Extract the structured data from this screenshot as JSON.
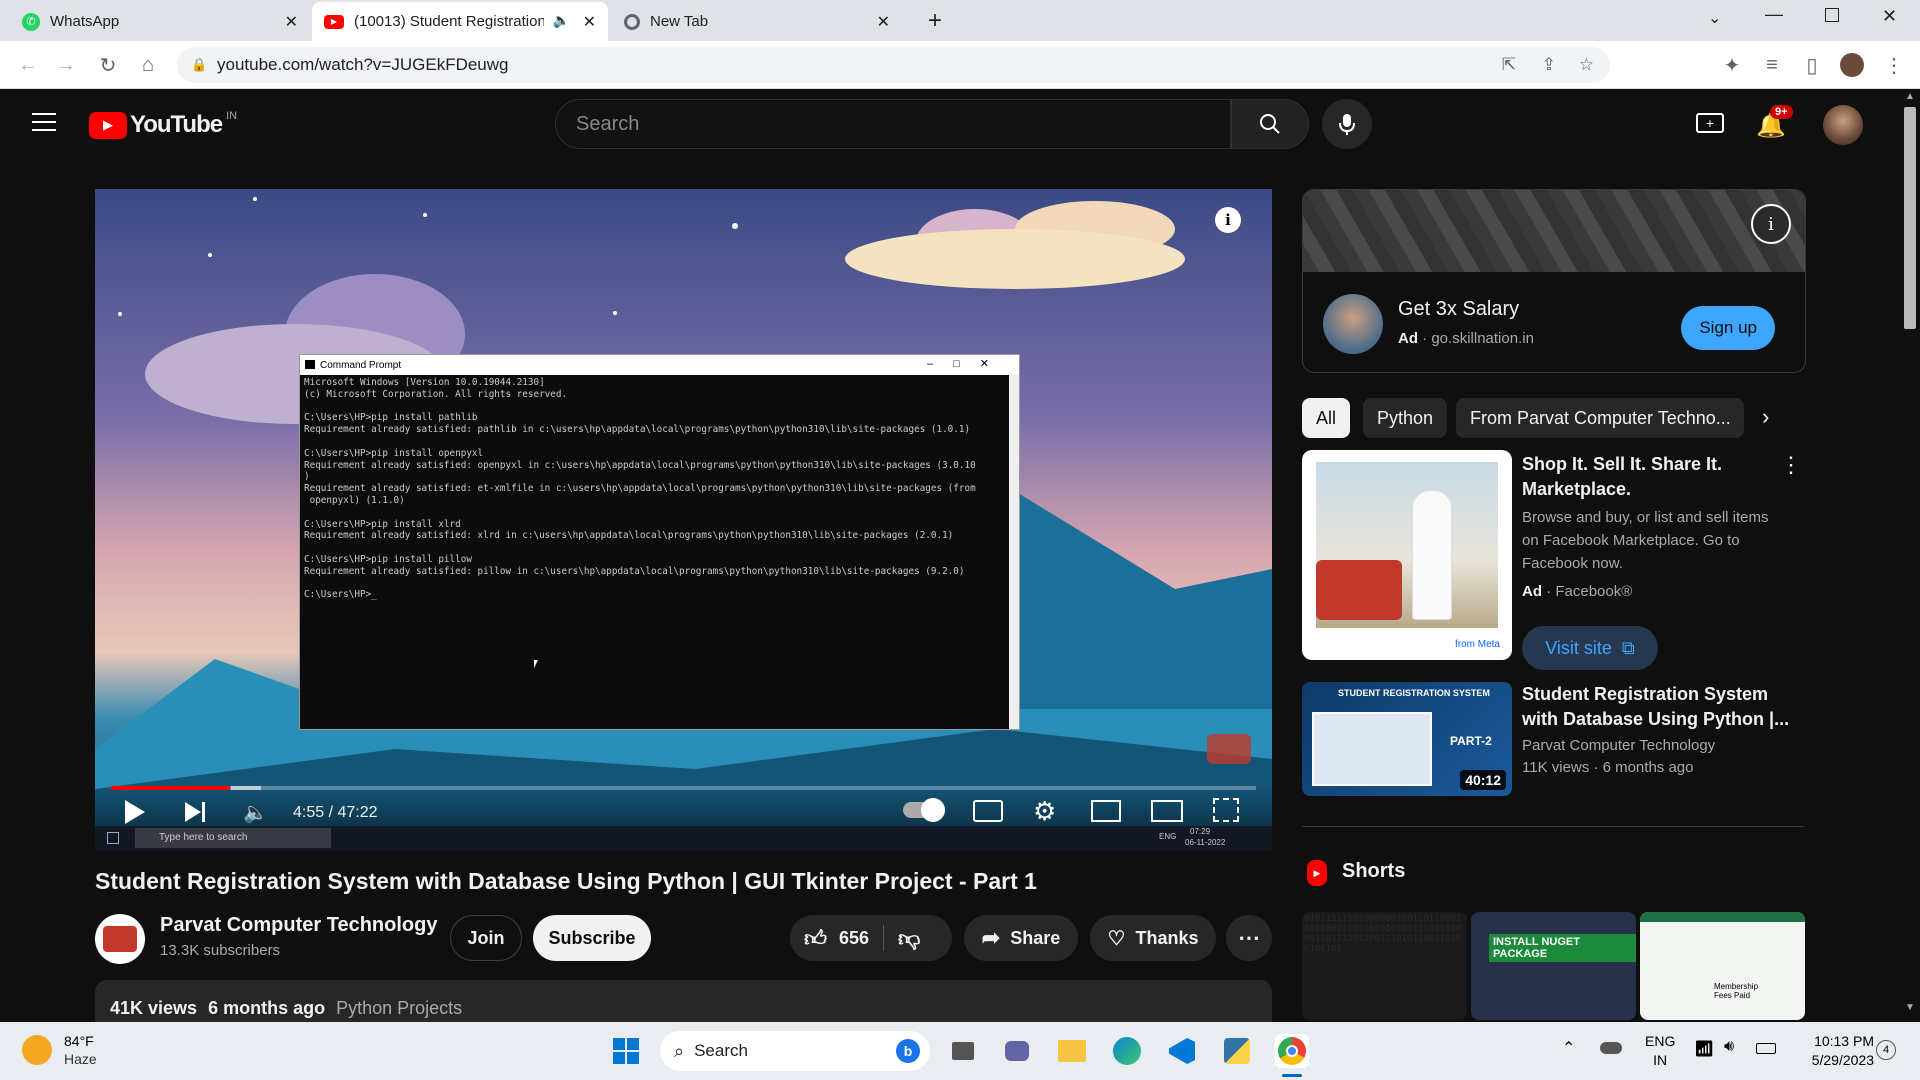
{
  "browser": {
    "tabs": [
      {
        "title": "WhatsApp"
      },
      {
        "title": "(10013) Student Registration"
      },
      {
        "title": "New Tab"
      }
    ],
    "url": "youtube.com/watch?v=JUGEkFDeuwg"
  },
  "youtube": {
    "logo": "YouTube",
    "region": "IN",
    "search_placeholder": "Search",
    "notifications": "9+"
  },
  "player": {
    "time": "4:55 / 47:22",
    "progress_fraction": 0.104,
    "cmd_title": "Command Prompt",
    "cmd_lines": [
      "Microsoft Windows [Version 10.0.19044.2130]",
      "(c) Microsoft Corporation. All rights reserved.",
      "",
      "C:\\Users\\HP>pip install pathlib",
      "Requirement already satisfied: pathlib in c:\\users\\hp\\appdata\\local\\programs\\python\\python310\\lib\\site-packages (1.0.1)",
      "",
      "C:\\Users\\HP>pip install openpyxl",
      "Requirement already satisfied: openpyxl in c:\\users\\hp\\appdata\\local\\programs\\python\\python310\\lib\\site-packages (3.0.10",
      ")",
      "Requirement already satisfied: et-xmlfile in c:\\users\\hp\\appdata\\local\\programs\\python\\python310\\lib\\site-packages (from",
      " openpyxl) (1.1.0)",
      "",
      "C:\\Users\\HP>pip install xlrd",
      "Requirement already satisfied: xlrd in c:\\users\\hp\\appdata\\local\\programs\\python\\python310\\lib\\site-packages (2.0.1)",
      "",
      "C:\\Users\\HP>pip install pillow",
      "Requirement already satisfied: pillow in c:\\users\\hp\\appdata\\local\\programs\\python\\python310\\lib\\site-packages (9.2.0)",
      "",
      "C:\\Users\\HP>_"
    ],
    "inner_taskbar_search": "Type here to search",
    "inner_clock": "07:29",
    "inner_date": "06-11-2022",
    "inner_lang": "ENG"
  },
  "video": {
    "title": "Student Registration System with Database Using Python | GUI Tkinter Project - Part 1",
    "channel": "Parvat Computer Technology",
    "subscribers": "13.3K subscribers",
    "join": "Join",
    "subscribe": "Subscribe",
    "likes": "656",
    "share": "Share",
    "thanks": "Thanks",
    "views": "41K views",
    "age": "6 months ago",
    "playlist": "Python Projects"
  },
  "sidebar": {
    "ad": {
      "title": "Get 3x Salary",
      "ad_label": "Ad",
      "domain": "go.skillnation.in",
      "cta": "Sign up"
    },
    "chips": [
      "All",
      "Python",
      "From Parvat Computer Techno..."
    ],
    "promo": {
      "title": "Shop It. Sell It. Share It. Marketplace.",
      "desc": "Browse and buy, or list and sell items on Facebook Marketplace. Go to Facebook now.",
      "ad_label": "Ad",
      "source": "Facebook®",
      "cta": "Visit site",
      "thumb_brand": "from Meta"
    },
    "video": {
      "title": "Student Registration System with Database Using Python |...",
      "channel": "Parvat Computer Technology",
      "meta": "11K views · 6 months ago",
      "duration": "40:12",
      "thumb_heading": "STUDENT REGISTRATION SYSTEM",
      "thumb_part": "PART-2"
    },
    "shorts_heading": "Shorts",
    "shorts": [
      {
        "label": ""
      },
      {
        "label": "INSTALL NUGET PACKAGE"
      },
      {
        "label": "Membership Fees Paid"
      }
    ]
  },
  "taskbar": {
    "weather_temp": "84°F",
    "weather_desc": "Haze",
    "search": "Search",
    "lang1": "ENG",
    "lang2": "IN",
    "time": "10:13 PM",
    "date": "5/29/2023",
    "notif_count": "4"
  },
  "colors": {
    "yt_red": "#ff0000",
    "signup_blue": "#3ea6ff",
    "bg": "#0f0f0f"
  }
}
